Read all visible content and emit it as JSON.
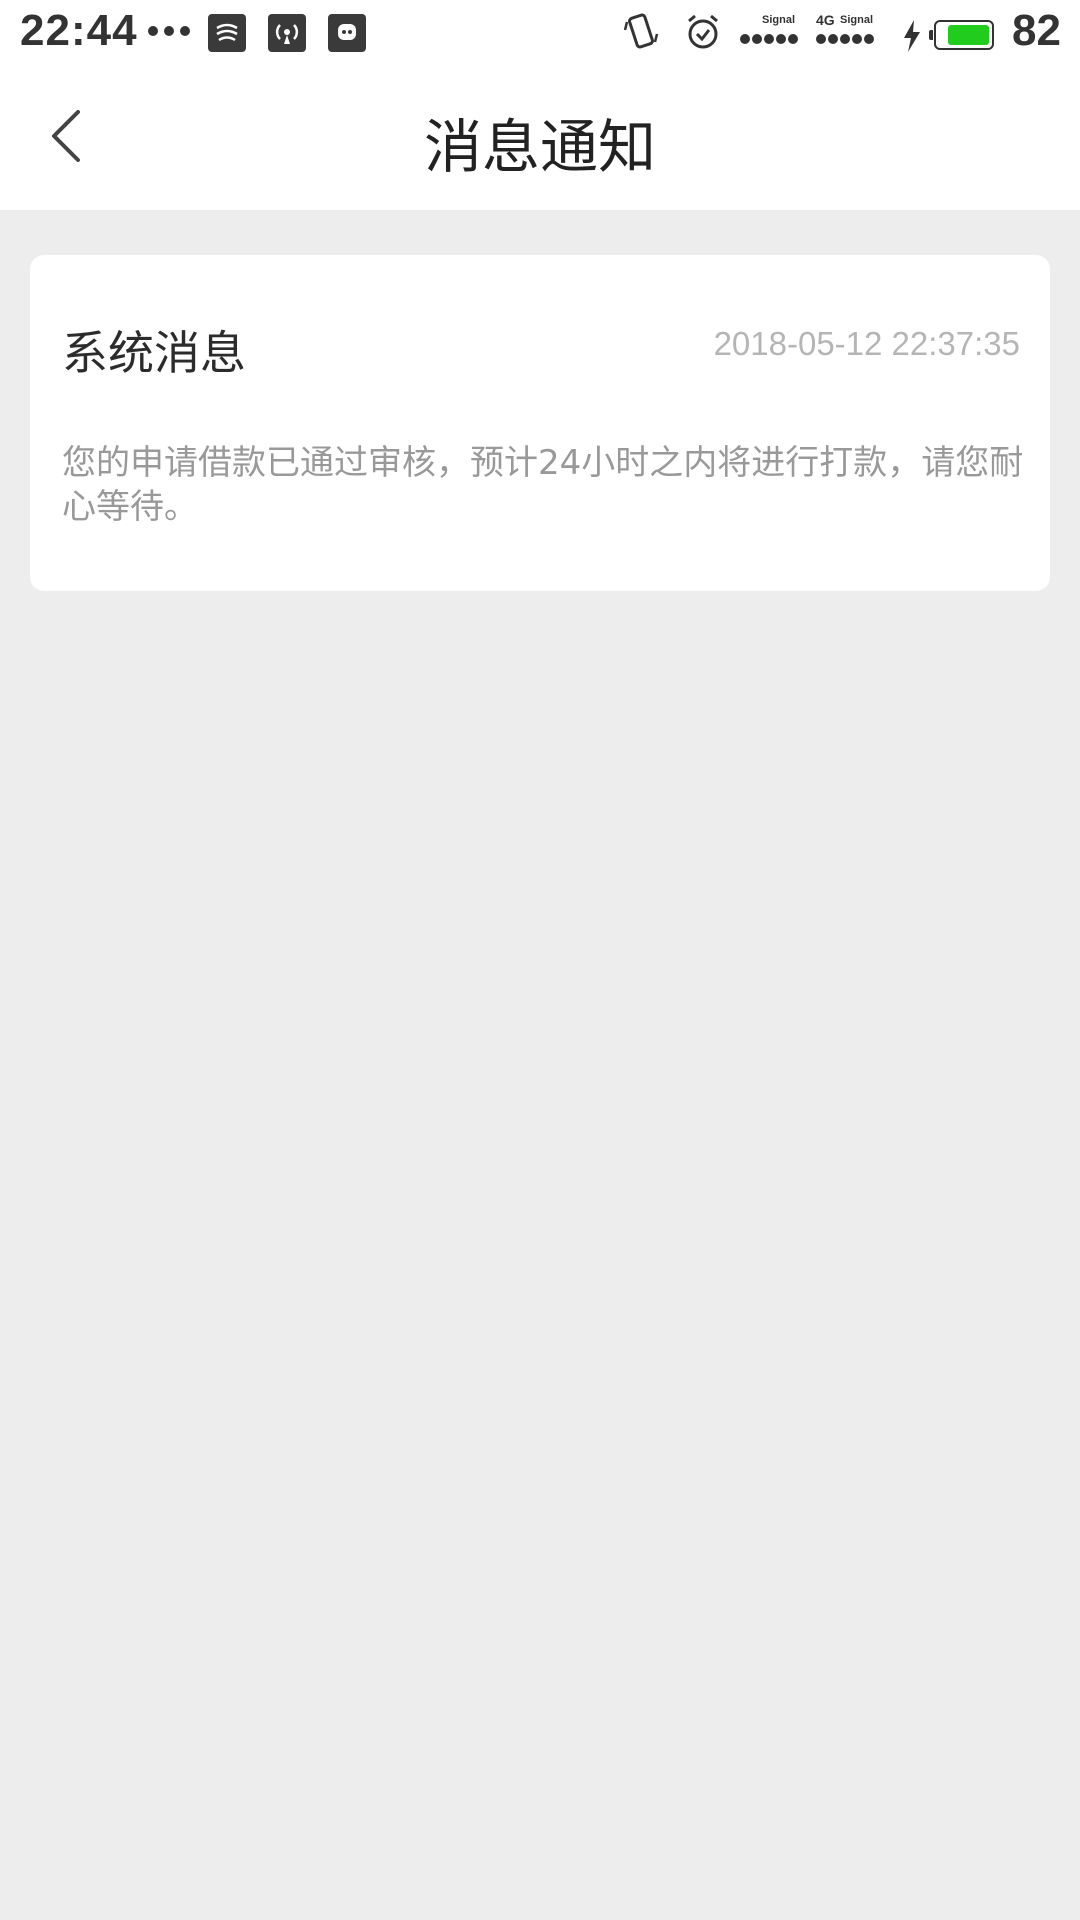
{
  "status_bar": {
    "time": "22:44",
    "signal_label_1": "Signal",
    "signal_label_2_network": "4G",
    "signal_label_2": "Signal",
    "battery_level": "82",
    "battery_fill_fraction": 0.82,
    "battery_color": "#22cc1e",
    "icons": [
      "more-dots-icon",
      "app-notification-icon",
      "hotspot-icon",
      "chat-app-icon",
      "vibrate-icon",
      "alarm-icon",
      "signal-icon",
      "signal-4g-icon",
      "charging-icon",
      "battery-icon"
    ]
  },
  "header": {
    "back_icon": "chevron-left-icon",
    "title": "消息通知"
  },
  "messages": [
    {
      "title": "系统消息",
      "time": "2018-05-12 22:37:35",
      "body": "您的申请借款已通过审核，预计24小时之内将进行打款，请您耐心等待。"
    }
  ],
  "colors": {
    "background": "#ededed",
    "card": "#ffffff",
    "title_text": "#222222",
    "muted_text": "#999999",
    "time_text": "#b5b5b5"
  }
}
